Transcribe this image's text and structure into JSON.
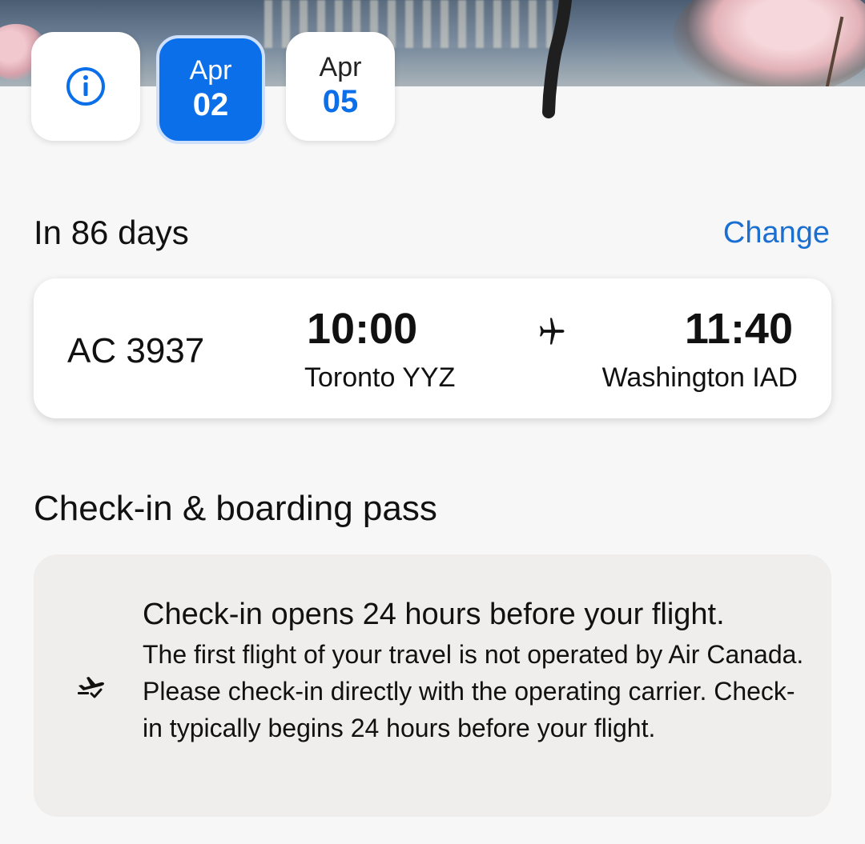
{
  "dates": {
    "info_icon": "info-circle-icon",
    "selected": {
      "month": "Apr",
      "day": "02"
    },
    "other": {
      "month": "Apr",
      "day": "05"
    }
  },
  "trip": {
    "countdown": "In 86 days",
    "change_label": "Change"
  },
  "flight": {
    "number": "AC 3937",
    "departure": {
      "time": "10:00",
      "city": "Toronto YYZ"
    },
    "arrival": {
      "time": "11:40",
      "city": "Washington IAD"
    },
    "icon": "airplane-icon"
  },
  "checkin": {
    "section_title": "Check-in & boarding pass",
    "headline": "Check-in opens 24 hours before your flight.",
    "body": "The first flight of your travel is not operated by Air Canada. Please check-in directly with the operating carrier. Check-in typically begins 24 hours before your flight.",
    "icon": "flight-checkin-icon"
  },
  "colors": {
    "accent": "#0a6fe8",
    "link": "#1a6fd1",
    "background": "#f7f7f7",
    "card": "#ffffff",
    "notice_card": "#efeeec"
  }
}
